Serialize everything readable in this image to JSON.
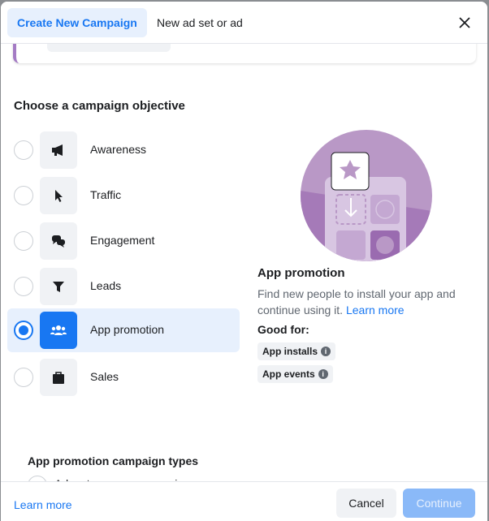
{
  "header": {
    "tabs": [
      {
        "label": "Create New Campaign",
        "active": true
      },
      {
        "label": "New ad set or ad",
        "active": false
      }
    ],
    "close_icon": "close-icon"
  },
  "objective_title": "Choose a campaign objective",
  "objectives": [
    {
      "label": "Awareness",
      "icon": "megaphone-icon",
      "selected": false
    },
    {
      "label": "Traffic",
      "icon": "cursor-icon",
      "selected": false
    },
    {
      "label": "Engagement",
      "icon": "chat-bubbles-icon",
      "selected": false
    },
    {
      "label": "Leads",
      "icon": "funnel-icon",
      "selected": false
    },
    {
      "label": "App promotion",
      "icon": "people-icon",
      "selected": true
    },
    {
      "label": "Sales",
      "icon": "shopping-bag-icon",
      "selected": false
    }
  ],
  "detail": {
    "title": "App promotion",
    "description": "Find new people to install your app and continue using it.",
    "learn_more": "Learn more",
    "good_for_label": "Good for:",
    "good_for": [
      "App installs",
      "App events"
    ]
  },
  "campaign_types": {
    "title": "App promotion campaign types",
    "option": "Advantage+ app campaigns"
  },
  "footer": {
    "learn_more": "Learn more",
    "cancel": "Cancel",
    "continue": "Continue"
  },
  "colors": {
    "accent": "#1877f2",
    "selected_bg": "#e7f0fd",
    "illustration": "#b998c6",
    "continue_disabled": "#8ab9f8"
  }
}
